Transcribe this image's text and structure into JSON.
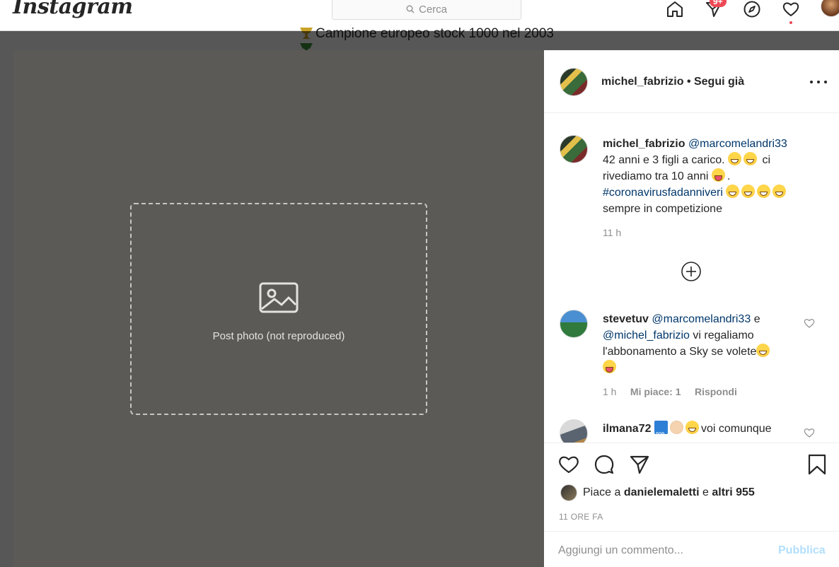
{
  "topbar": {
    "logo": "Instagram",
    "search_placeholder": "Cerca",
    "icons": [
      "home-icon",
      "direct-icon",
      "explore-icon",
      "activity-icon",
      "profile-avatar"
    ],
    "direct_badge": "9+"
  },
  "background_bio": {
    "line1": "Campione europeo stock 1000 nel 2003"
  },
  "post": {
    "photo_alt": "Post photo (not reproduced)",
    "author": "michel_fabrizio",
    "follow_state": "Segui già",
    "caption": {
      "user": "michel_fabrizio",
      "mention": "@marcomelandri33",
      "text1": "42 anni e 3 figli a carico.",
      "text2": "ci",
      "text3": "rivediamo tra 10 anni",
      "text4": ".",
      "hashtag": "#coronavirusfadanniveri",
      "text5": "sempre in competizione",
      "time": "11 h"
    },
    "comments": [
      {
        "user": "stevetuv",
        "mention1": "@marcomelandri33",
        "joiner": "e",
        "mention2": "@michel_fabrizio",
        "text": "vi regaliamo l'abbonamento a Sky se volete",
        "time": "1 h",
        "likes": "Mi piace: 1",
        "reply": "Rispondi"
      },
      {
        "user": "ilmana72",
        "text": "voi comunque"
      }
    ],
    "liked_by_prefix": "Piace a",
    "liked_by_user": "danielemaletti",
    "liked_by_joiner": "e",
    "liked_by_others": "altri 955",
    "timestamp": "11 ORE FA",
    "add_comment_placeholder": "Aggiungi un commento...",
    "publish_label": "Pubblica"
  }
}
